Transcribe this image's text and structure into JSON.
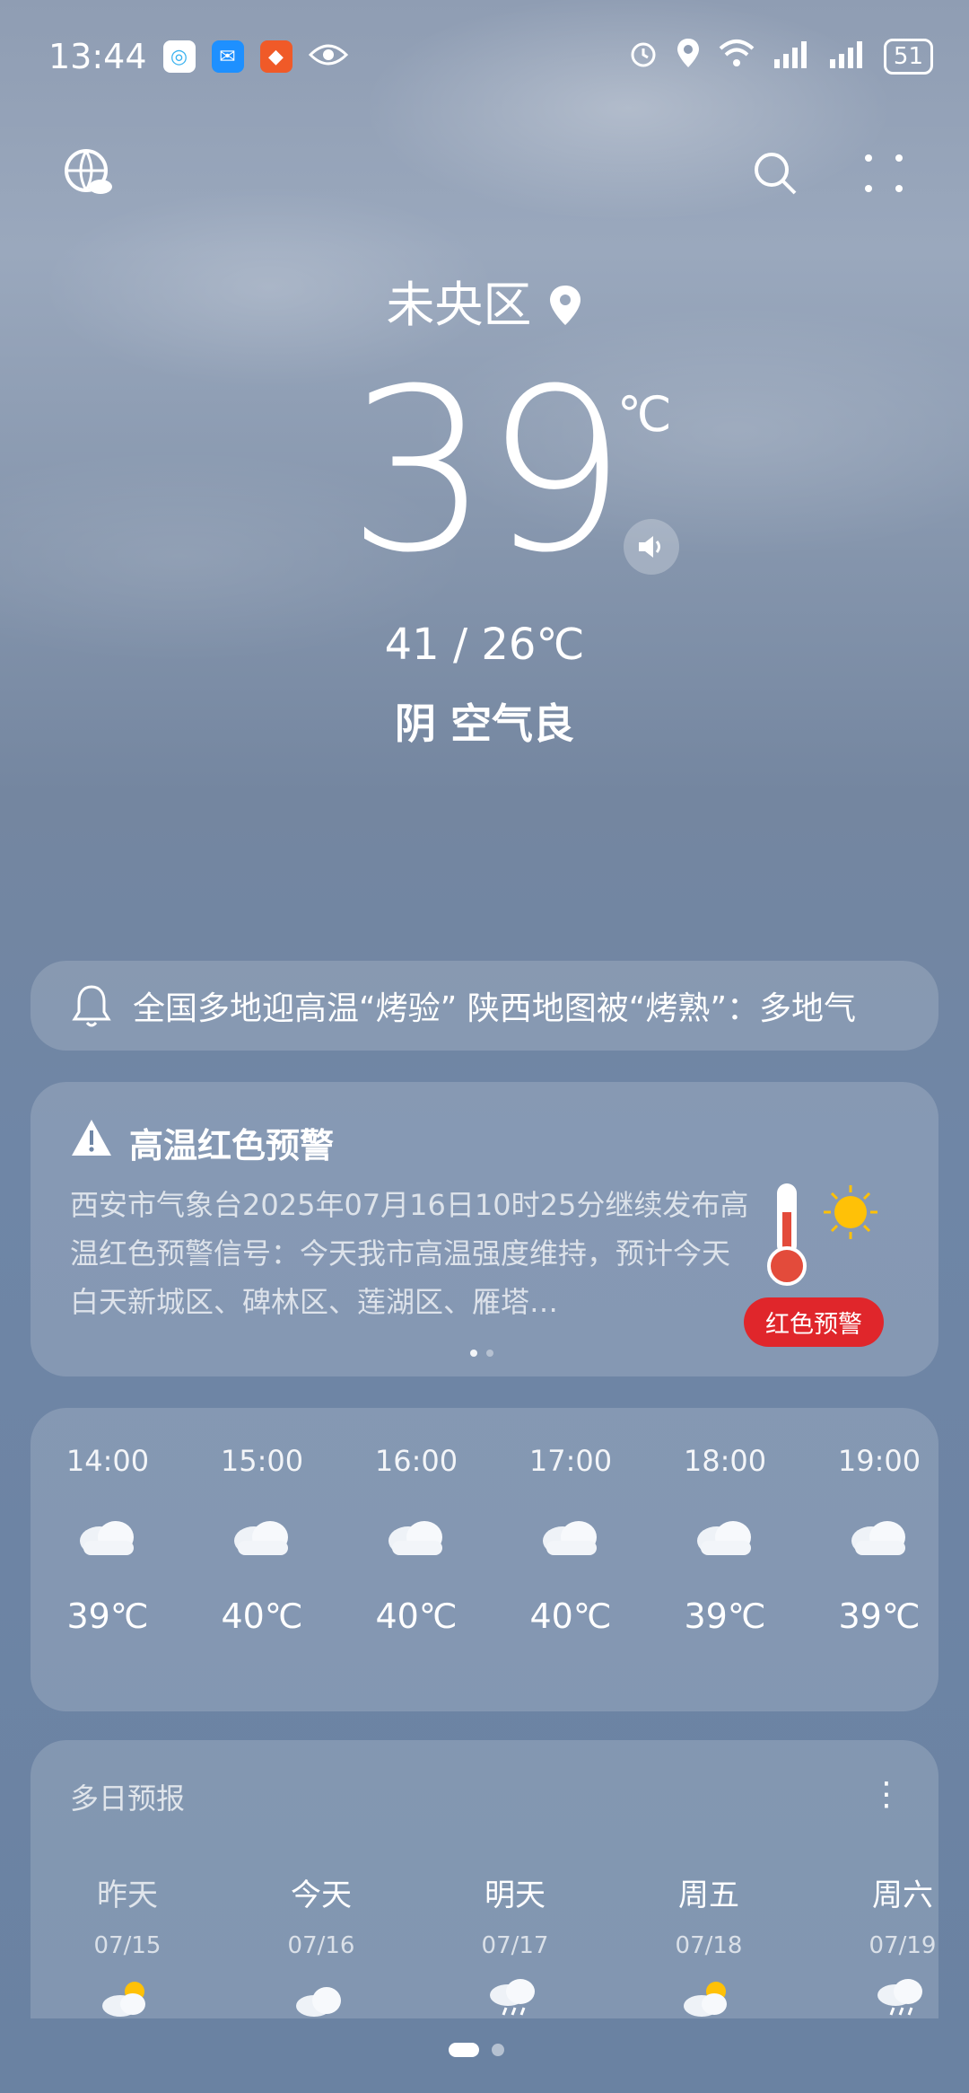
{
  "status": {
    "time": "13:44",
    "battery": "51"
  },
  "location": {
    "city": "未央区"
  },
  "current": {
    "temp": "39",
    "unit": "℃",
    "range": "41 / 26℃",
    "condition": "阴  空气良"
  },
  "news": {
    "text": "全国多地迎高温“烤验” 陕西地图被“烤熟”：多地气"
  },
  "alert": {
    "title": "高温红色预警",
    "body": "西安市气象台2025年07月16日10时25分继续发布高温红色预警信号：今天我市高温强度维持，预计今天白天新城区、碑林区、莲湖区、雁塔…",
    "badge": "红色预警"
  },
  "hourly": [
    {
      "time": "14:00",
      "temp": "39℃",
      "icon": "cloud-icon"
    },
    {
      "time": "15:00",
      "temp": "40℃",
      "icon": "cloud-icon"
    },
    {
      "time": "16:00",
      "temp": "40℃",
      "icon": "cloud-icon"
    },
    {
      "time": "17:00",
      "temp": "40℃",
      "icon": "cloud-icon"
    },
    {
      "time": "18:00",
      "temp": "39℃",
      "icon": "cloud-icon"
    },
    {
      "time": "19:00",
      "temp": "39℃",
      "icon": "cloud-icon"
    }
  ],
  "daily": {
    "title": "多日预报",
    "days": [
      {
        "name": "昨天",
        "date": "07/15",
        "icon": "sun-cloud-icon"
      },
      {
        "name": "今天",
        "date": "07/16",
        "icon": "cloud-icon"
      },
      {
        "name": "明天",
        "date": "07/17",
        "icon": "rain-icon"
      },
      {
        "name": "周五",
        "date": "07/18",
        "icon": "sun-cloud-icon"
      },
      {
        "name": "周六",
        "date": "07/19",
        "icon": "rain-icon"
      }
    ]
  }
}
